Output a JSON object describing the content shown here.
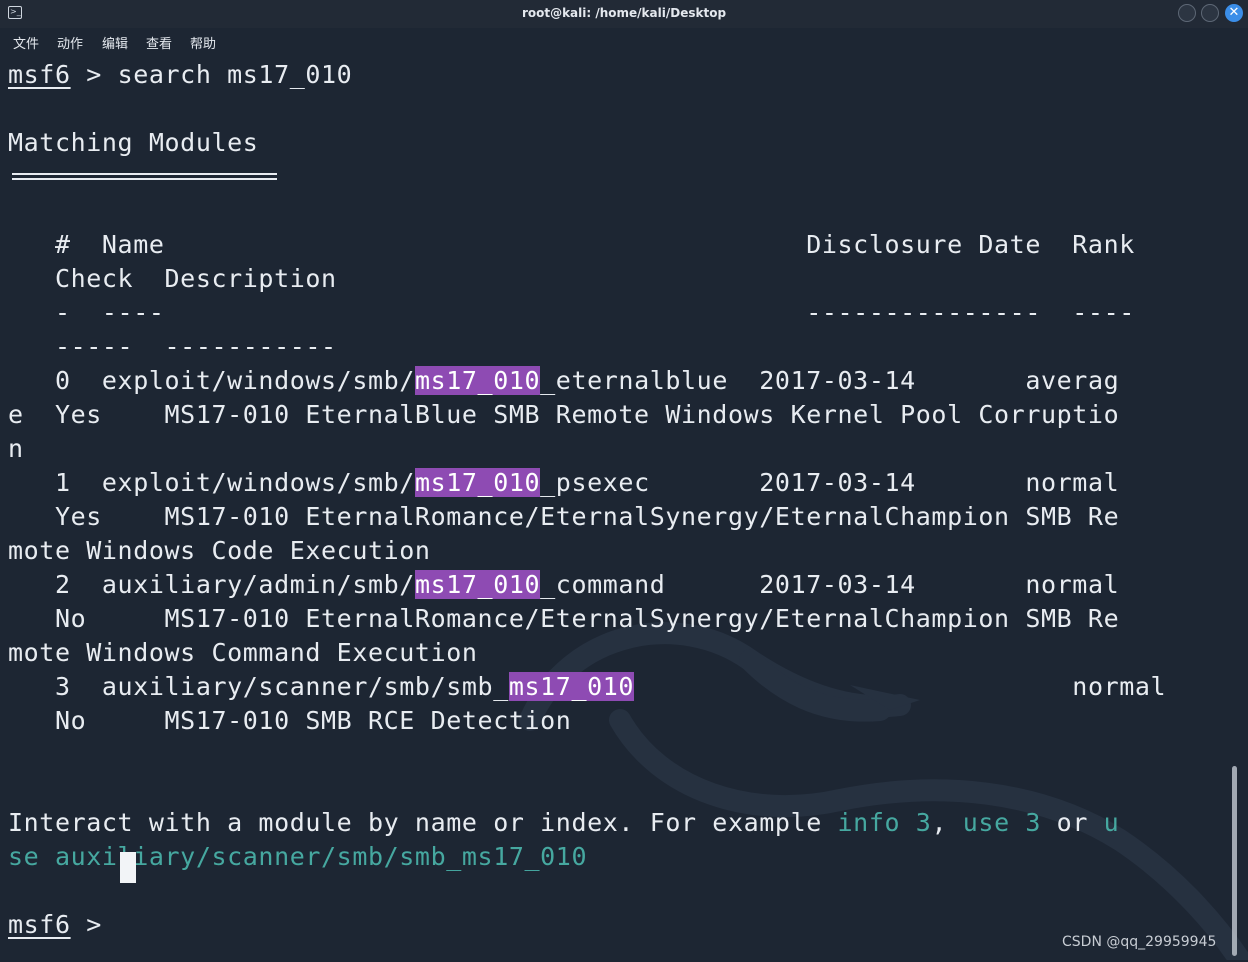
{
  "window": {
    "title": "root@kali: /home/kali/Desktop",
    "close_glyph": "✕"
  },
  "menu": {
    "items": [
      "文件",
      "动作",
      "编辑",
      "查看",
      "帮助"
    ]
  },
  "prompt": "msf6",
  "command": " > search ms17_010",
  "heading": "Matching Modules",
  "table": {
    "header_line1": "   #  Name                                         Disclosure Date  Rank",
    "header_line2": "   Check  Description",
    "sep_line1": "   -  ----                                         ---------------  ----",
    "sep_line2": "   -----  -----------",
    "rows": [
      {
        "l1_pre": "   0  exploit/windows/smb/",
        "l1_hl": "ms17_010",
        "l1_post": "_eternalblue  2017-03-14       averag",
        "l2": "e  Yes    MS17-010 EternalBlue SMB Remote Windows Kernel Pool Corruptio",
        "l3": "n"
      },
      {
        "l1_pre": "   1  exploit/windows/smb/",
        "l1_hl": "ms17_010",
        "l1_post": "_psexec       2017-03-14       normal",
        "l2": "   Yes    MS17-010 EternalRomance/EternalSynergy/EternalChampion SMB Re",
        "l3": "mote Windows Code Execution"
      },
      {
        "l1_pre": "   2  auxiliary/admin/smb/",
        "l1_hl": "ms17_010",
        "l1_post": "_command      2017-03-14       normal",
        "l2": "   No     MS17-010 EternalRomance/EternalSynergy/EternalChampion SMB Re",
        "l3": "mote Windows Command Execution"
      },
      {
        "l1_pre": "   3  auxiliary/scanner/smb/smb_",
        "l1_hl": "ms17_010",
        "l1_post": "                            normal",
        "l2": "   No     MS17-010 SMB RCE Detection"
      }
    ]
  },
  "hint": {
    "l1_a": "Interact with a module by name or index. For example ",
    "l1_info": "info 3",
    "l1_b": ", ",
    "l1_use": "use 3",
    "l1_c": " or ",
    "l1_u": "u",
    "l2_se": "se auxiliary/scanner/smb/smb_ms17_010"
  },
  "prompt2_rest": " > ",
  "watermark": "CSDN @qq_29959945",
  "colors": {
    "background": "#1d2633",
    "highlight": "#8e4bb3",
    "hint_green": "#46a8a0",
    "text": "#e8ecf1"
  }
}
